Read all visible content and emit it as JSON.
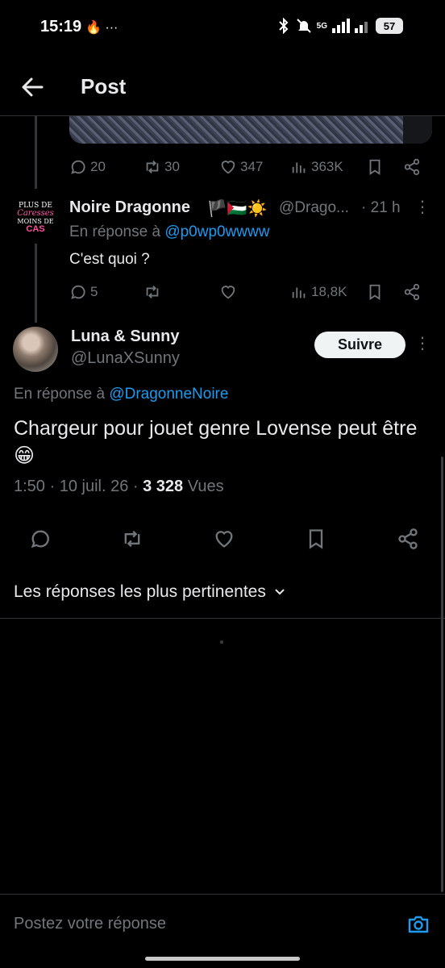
{
  "status_bar": {
    "time": "15:19",
    "left_icons": "🔥 ···",
    "network": "5G",
    "battery": "57"
  },
  "header": {
    "title": "Post"
  },
  "parent_tweet": {
    "stats": {
      "replies": "20",
      "reposts": "30",
      "likes": "347",
      "views": "363K"
    }
  },
  "reply_tweet": {
    "avatar_text": [
      "PLUS DE",
      "Caresses",
      "MOINS DE",
      "CAS"
    ],
    "name": "Noire Dragonne",
    "flags": "🏴🇵🇸☀️",
    "handle": "@Drago...",
    "time": "· 21 h",
    "reply_prefix": "En réponse à",
    "reply_to": "@p0wp0wwww",
    "text": "C'est quoi ?",
    "stats": {
      "replies": "5",
      "reposts": "",
      "likes": "",
      "views": "18,8K"
    }
  },
  "main_tweet": {
    "name": "Luna & Sunny",
    "handle": "@LunaXSunny",
    "follow_label": "Suivre",
    "reply_prefix": "En réponse à",
    "reply_to": "@DragonneNoire",
    "text": "Chargeur pour jouet genre Lovense peut être 😁",
    "timestamp": "1:50 · 10 juil. 26 ·",
    "views_count": "3 328",
    "views_label": "Vues"
  },
  "sort": {
    "label": "Les réponses les plus pertinentes"
  },
  "composer": {
    "placeholder": "Postez votre réponse"
  },
  "colors": {
    "background": "#000000",
    "text": "#e7e9ea",
    "muted": "#71767b",
    "link": "#1d9bf0"
  }
}
